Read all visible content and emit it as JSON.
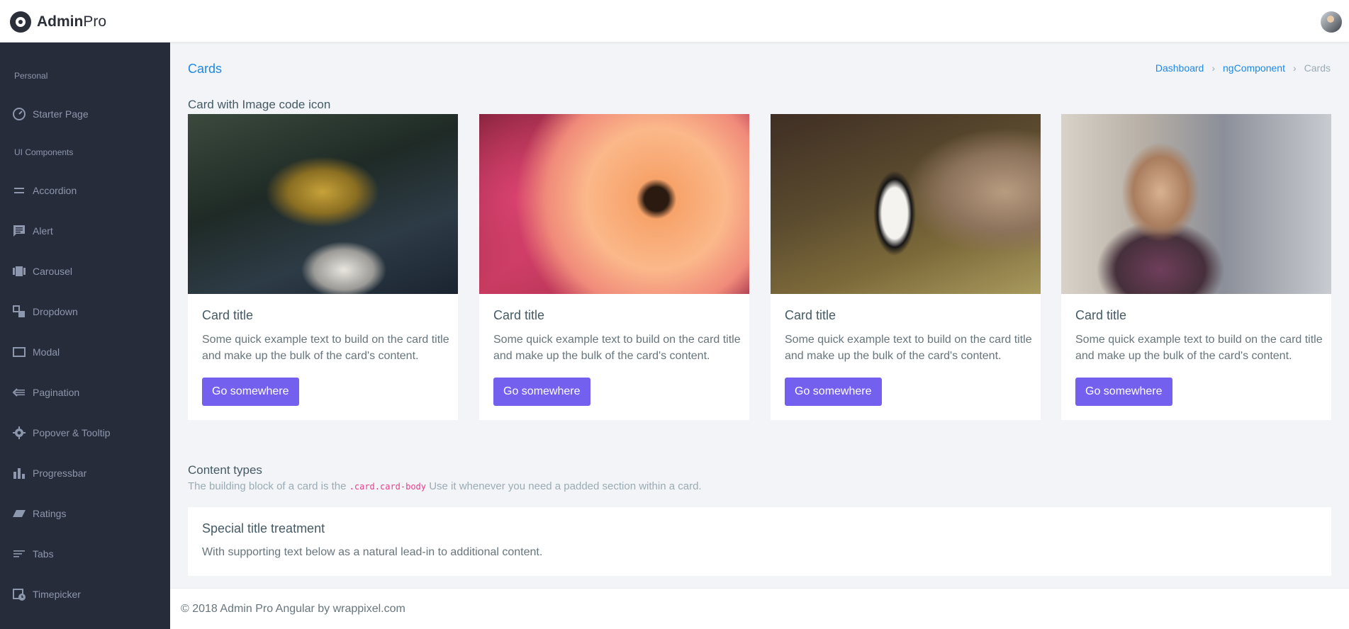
{
  "app": {
    "logo_bold": "Admin",
    "logo_light": "Pro"
  },
  "sidebar": {
    "sections": [
      {
        "label": "Personal"
      },
      {
        "label": "UI Components"
      }
    ],
    "items": [
      {
        "label": "Starter Page",
        "icon": "gauge-icon"
      },
      {
        "label": "Accordion",
        "icon": "equal-icon"
      },
      {
        "label": "Alert",
        "icon": "message-icon"
      },
      {
        "label": "Carousel",
        "icon": "carousel-icon"
      },
      {
        "label": "Dropdown",
        "icon": "dropdown-icon"
      },
      {
        "label": "Modal",
        "icon": "window-icon"
      },
      {
        "label": "Pagination",
        "icon": "arrow-left-icon"
      },
      {
        "label": "Popover & Tooltip",
        "icon": "gear-icon"
      },
      {
        "label": "Progressbar",
        "icon": "bar-chart-icon"
      },
      {
        "label": "Ratings",
        "icon": "parallelogram-icon"
      },
      {
        "label": "Tabs",
        "icon": "lines-icon"
      },
      {
        "label": "Timepicker",
        "icon": "calendar-clock-icon"
      }
    ]
  },
  "header": {
    "page_title": "Cards",
    "breadcrumb": [
      "Dashboard",
      "ngComponent",
      "Cards"
    ]
  },
  "section1": {
    "title": "Card with Image code icon"
  },
  "cards": [
    {
      "title": "Card title",
      "text": "Some quick example text to build on the card title and make up the bulk of the card's content.",
      "button": "Go somewhere"
    },
    {
      "title": "Card title",
      "text": "Some quick example text to build on the card title and make up the bulk of the card's content.",
      "button": "Go somewhere"
    },
    {
      "title": "Card title",
      "text": "Some quick example text to build on the card title and make up the bulk of the card's content.",
      "button": "Go somewhere"
    },
    {
      "title": "Card title",
      "text": "Some quick example text to build on the card title and make up the bulk of the card's content.",
      "button": "Go somewhere"
    }
  ],
  "section2": {
    "title": "Content types",
    "sub_before": "The building block of a card is the",
    "sub_code": ".card.card-body",
    "sub_after": "Use it whenever you need a padded section within a card."
  },
  "special_card": {
    "title": "Special title treatment",
    "text": "With supporting text below as a natural lead-in to additional content."
  },
  "footer": {
    "text": "© 2018 Admin Pro Angular by wrappixel.com"
  },
  "colors": {
    "accent": "#1e88e5",
    "button": "#7460ee",
    "sidebar_bg": "#272c3a",
    "page_bg": "#f2f4f8"
  }
}
